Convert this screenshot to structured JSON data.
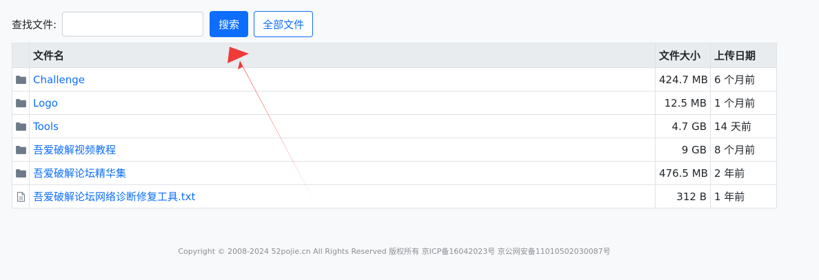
{
  "search": {
    "label": "查找文件:",
    "value": "",
    "button_label": "搜索",
    "all_files_label": "全部文件"
  },
  "table": {
    "headers": {
      "name": "文件名",
      "size": "文件大小",
      "date": "上传日期"
    },
    "rows": [
      {
        "type": "folder",
        "icon": "folder-icon",
        "name": "Challenge",
        "size": "424.7 MB",
        "date": "6 个月前"
      },
      {
        "type": "folder",
        "icon": "folder-icon",
        "name": "Logo",
        "size": "12.5 MB",
        "date": "1 个月前"
      },
      {
        "type": "folder",
        "icon": "folder-icon",
        "name": "Tools",
        "size": "4.7 GB",
        "date": "14 天前"
      },
      {
        "type": "folder",
        "icon": "folder-icon",
        "name": "吾爱破解视频教程",
        "size": "9 GB",
        "date": "8 个月前"
      },
      {
        "type": "folder",
        "icon": "folder-icon",
        "name": "吾爱破解论坛精华集",
        "size": "476.5 MB",
        "date": "2 年前"
      },
      {
        "type": "file",
        "icon": "file-icon",
        "name": "吾爱破解论坛网络诊断修复工具.txt",
        "size": "312 B",
        "date": "1 年前"
      }
    ]
  },
  "footer": {
    "text": "Copyright © 2008-2024 52pojie.cn All Rights Reserved 版权所有 京ICP备16042023号 京公网安备11010502030087号"
  },
  "colors": {
    "primary": "#0d6efd",
    "arrow": "#f03a3a",
    "header_bg": "#e9ecef",
    "icon": "#6c7a89"
  }
}
